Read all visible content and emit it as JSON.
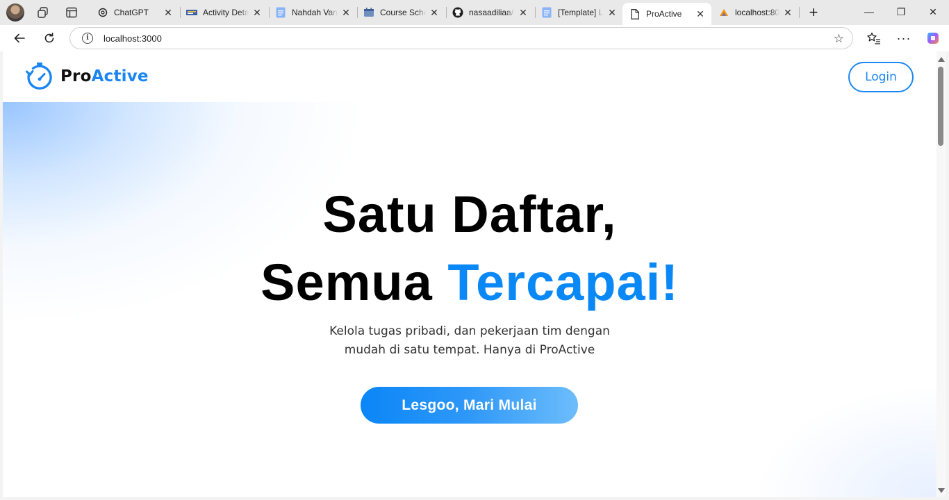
{
  "browser": {
    "tabs": [
      {
        "title": "ChatGPT",
        "icon": "chatgpt-icon",
        "active": false
      },
      {
        "title": "Activity Deta",
        "icon": "site-icon",
        "active": false
      },
      {
        "title": "Nahdah Van",
        "icon": "docs-icon",
        "active": false
      },
      {
        "title": "Course Sche",
        "icon": "calendar-icon",
        "active": false
      },
      {
        "title": "nasaadiliaa/",
        "icon": "github-icon",
        "active": false
      },
      {
        "title": "[Template] L",
        "icon": "docs-icon",
        "active": false
      },
      {
        "title": "ProActive",
        "icon": "page-icon",
        "active": true
      },
      {
        "title": "localhost:80",
        "icon": "phpmyadmin-icon",
        "active": false
      }
    ],
    "close_glyph": "✕",
    "new_tab_glyph": "+",
    "url": "localhost:3000",
    "controls": {
      "minimize": "—",
      "restore": "❐",
      "close": "✕"
    }
  },
  "page": {
    "brand": {
      "part1": "Pro",
      "part2": "Active"
    },
    "login_label": "Login",
    "headline_line1": "Satu Daftar,",
    "headline_line2_plain": "Semua ",
    "headline_line2_accent": "Tercapai!",
    "subtitle_line1": "Kelola tugas pribadi, dan pekerjaan tim dengan",
    "subtitle_line2": "mudah di satu tempat. Hanya di ProActive",
    "cta_label": "Lesgoo, Mari Mulai"
  },
  "colors": {
    "accent": "#1b86f2",
    "headline_accent": "#0a88f5",
    "cta_start": "#0a86f7",
    "cta_end": "#6dbdfb"
  }
}
